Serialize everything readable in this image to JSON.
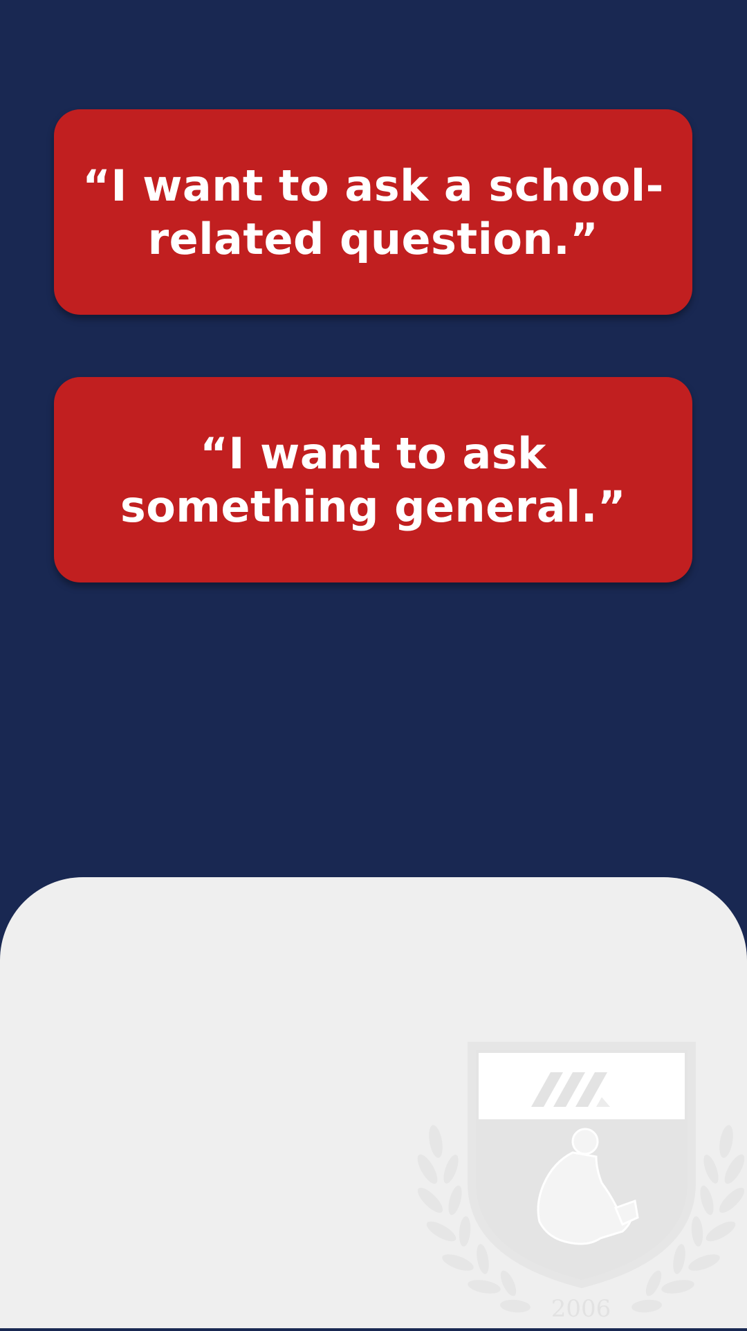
{
  "options": [
    {
      "label": "“I want to ask a school-related question.”"
    },
    {
      "label": "“I want to ask something general.”"
    }
  ],
  "crest": {
    "icon": "school-crest-icon",
    "year": "2006"
  },
  "colors": {
    "background": "#192852",
    "card": "#c11f20",
    "card_text": "#ffffff",
    "panel": "#efefef",
    "crest": "#e6e6e6"
  }
}
